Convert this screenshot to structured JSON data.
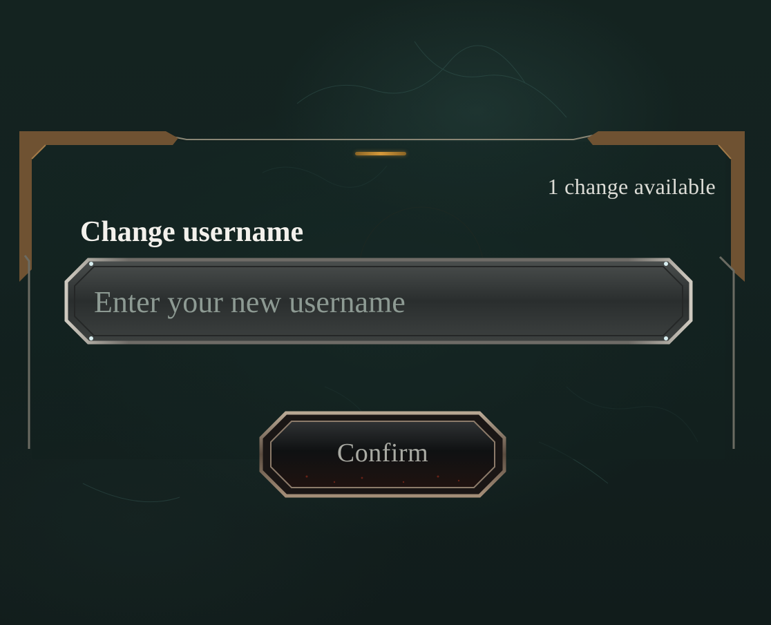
{
  "dialog": {
    "changes_available": "1 change available",
    "title": "Change username",
    "input": {
      "placeholder": "Enter your new username",
      "value": ""
    },
    "confirm_label": "Confirm"
  },
  "colors": {
    "frame_gold": "#7a5a33",
    "accent_gold": "#d79a3a",
    "panel_line": "#6b6b62",
    "background": "#132220"
  }
}
